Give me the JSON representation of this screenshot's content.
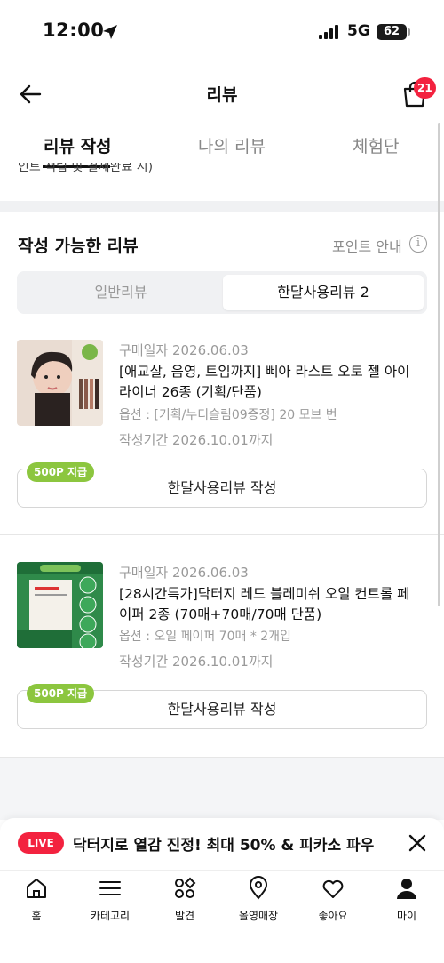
{
  "status_bar": {
    "time": "12:00",
    "network": "5G",
    "battery": "62"
  },
  "header": {
    "title": "리뷰",
    "cart_count": "21"
  },
  "tabs": [
    {
      "label": "리뷰 작성",
      "active": true
    },
    {
      "label": "나의 리뷰",
      "active": false
    },
    {
      "label": "체험단",
      "active": false
    }
  ],
  "notice_cut": "인트 적립 및 결제완료 시)",
  "section": {
    "title": "작성 가능한 리뷰",
    "point_info": "포인트 안내",
    "info_icon": "info-icon"
  },
  "segment": {
    "left": "일반리뷰",
    "right": "한달사용리뷰 2"
  },
  "products": [
    {
      "purchase_date": "구매일자 2026.06.03",
      "name": "[애교살, 음영, 트임까지] 삐아 라스트 오토 젤 아이라이너 26종 (기획/단품)",
      "option": "옵션 : [기획/누디슬림09증정] 20 모브 번",
      "period": "작성기간 2026.10.01까지",
      "badge": "500P 지급",
      "button": "한달사용리뷰 작성"
    },
    {
      "purchase_date": "구매일자 2026.06.03",
      "name": "[28시간특가]닥터지 레드 블레미쉬 오일 컨트롤 페이퍼 2종 (70매+70매/70매 단품)",
      "option": "옵션 : 오일 페이퍼 70매 * 2개입",
      "period": "작성기간 2026.10.01까지",
      "badge": "500P 지급",
      "button": "한달사용리뷰 작성",
      "thumb_text": "28시간 특가"
    }
  ],
  "live_banner": {
    "badge": "LIVE",
    "text": "닥터지로 열감 진정! 최대 50% & 피카소 파우..."
  },
  "bottom_nav": [
    {
      "label": "홈",
      "icon": "home-icon"
    },
    {
      "label": "카테고리",
      "icon": "menu-icon"
    },
    {
      "label": "발견",
      "icon": "discover-icon"
    },
    {
      "label": "올영매장",
      "icon": "location-pin-icon"
    },
    {
      "label": "좋아요",
      "icon": "heart-icon"
    },
    {
      "label": "마이",
      "icon": "person-icon"
    }
  ],
  "colors": {
    "accent_red": "#f3223f",
    "point_green": "#8cc63f",
    "muted": "#9a9a9a"
  }
}
